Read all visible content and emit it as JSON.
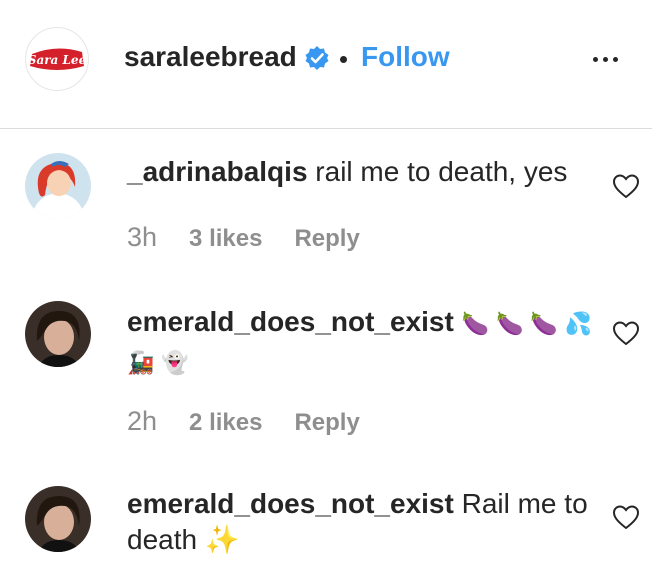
{
  "header": {
    "logo_text": "Sara Lee",
    "username": "saraleebread",
    "follow_label": "Follow",
    "verified_icon": "verified-badge-icon",
    "more_icon": "more-options-icon"
  },
  "colors": {
    "follow_blue": "#3897f0",
    "logo_red": "#d4202a",
    "text": "#262626",
    "muted": "#8e8e8e"
  },
  "comments": [
    {
      "username": "_adrinabalqis",
      "text": "rail me to death, yes",
      "time": "3h",
      "likes": "3 likes",
      "reply": "Reply"
    },
    {
      "username": "emerald_does_not_exist",
      "text": "🍆 🍆  🍆 💦 🚂 👻",
      "time": "2h",
      "likes": "2 likes",
      "reply": "Reply"
    },
    {
      "username": "emerald_does_not_exist",
      "text": "Rail me to death ✨",
      "time": "",
      "likes": "",
      "reply": ""
    }
  ]
}
